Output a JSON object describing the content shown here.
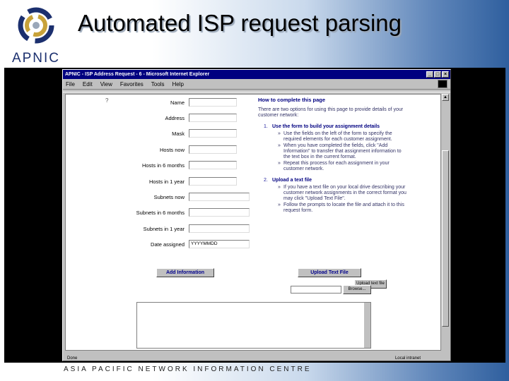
{
  "slide": {
    "title": "Automated ISP request parsing",
    "logo_text": "APNIC",
    "footer": "ASIA PACIFIC NETWORK INFORMATION CENTRE"
  },
  "browser": {
    "window_title": "APNIC - ISP Address Request - 6 - Microsoft Internet Explorer",
    "menu": [
      "File",
      "Edit",
      "View",
      "Favorites",
      "Tools",
      "Help"
    ],
    "status_left": "Done",
    "status_right": "Local intranet"
  },
  "form": {
    "help_mark": "?",
    "fields": [
      {
        "label": "Name",
        "value": ""
      },
      {
        "label": "Address",
        "value": ""
      },
      {
        "label": "Mask",
        "value": ""
      },
      {
        "label": "Hosts now",
        "value": ""
      },
      {
        "label": "Hosts in 6 months",
        "value": ""
      },
      {
        "label": "Hosts in 1 year",
        "value": ""
      },
      {
        "label": "Subnets now",
        "value": ""
      },
      {
        "label": "Subnets in 6 months",
        "value": ""
      },
      {
        "label": "Subnets in 1 year",
        "value": ""
      },
      {
        "label": "Date assigned",
        "value": "YYYYMMDD"
      }
    ],
    "add_button": "Add Information",
    "upload_button": "Upload Text File",
    "upload_small_button": "Upload text file",
    "browse_button": "Browse..."
  },
  "instructions": {
    "heading": "How to complete this page",
    "intro": "There are two options for using this page to provide details of your customer network:",
    "option1_title": "Use the form to build your assignment details",
    "option1_num": "1.",
    "option1_items": [
      "Use the fields on the left of the form to specify the required elements for each customer assignment.",
      "When you have completed the fields, click \"Add Information\" to transfer that assignment information to the text box in the current format.",
      "Repeat this process for each assignment in your customer network."
    ],
    "option2_num": "2.",
    "option2_title": "Upload a text file",
    "option2_items": [
      "If you have a text file on your local drive describing your customer network assignments in the correct format you may click \"Upload Text File\".",
      "Follow the prompts to locate the file and attach it to this request form."
    ]
  }
}
